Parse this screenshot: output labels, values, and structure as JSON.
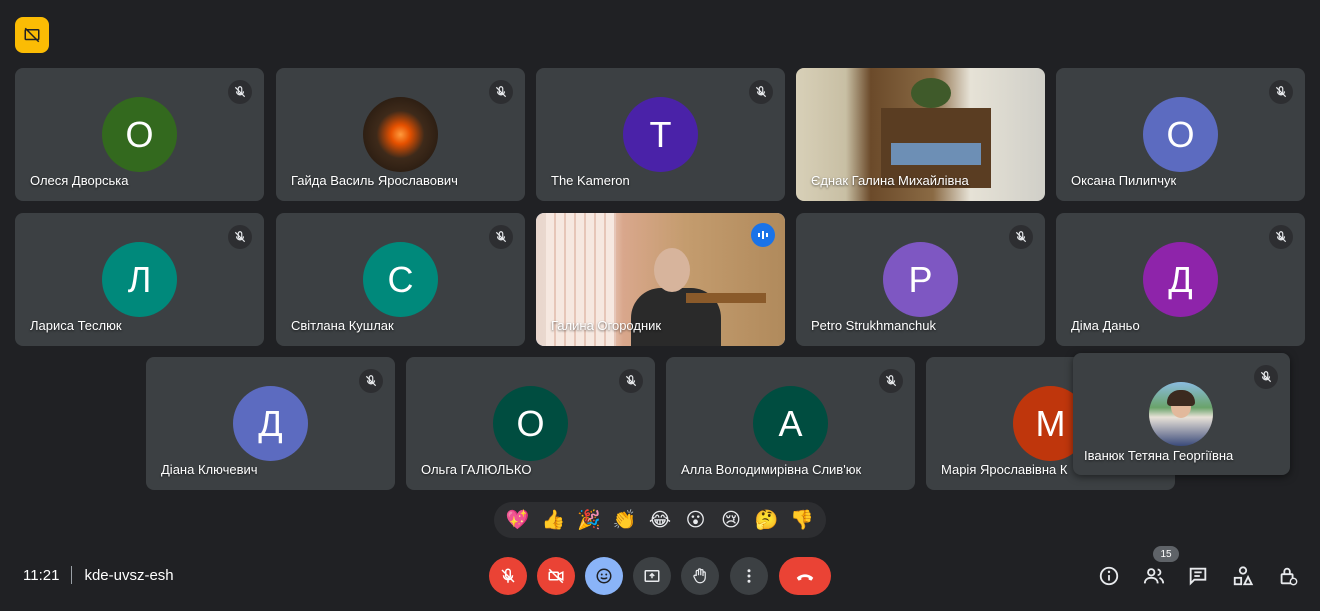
{
  "participants": [
    {
      "name": "Олеся Дворська",
      "initial": "О",
      "color": "#33691e"
    },
    {
      "name": "Гайда Василь Ярославович",
      "initial": "",
      "color": "#3e2a1a"
    },
    {
      "name": "The Kameron",
      "initial": "T",
      "color": "#4a22a8"
    },
    {
      "name": "Єднак Галина Михайлівна",
      "initial": "",
      "color": "#b9a98a"
    },
    {
      "name": "Оксана Пилипчук",
      "initial": "О",
      "color": "#5c6bc0"
    },
    {
      "name": "Лариса Теслюк",
      "initial": "Л",
      "color": "#00897b"
    },
    {
      "name": "Світлана Кушлак",
      "initial": "С",
      "color": "#00897b"
    },
    {
      "name": "Галина Огородник",
      "initial": "",
      "color": "#6d4c41"
    },
    {
      "name": "Petro Strukhmanchuk",
      "initial": "P",
      "color": "#7e57c2"
    },
    {
      "name": "Діма Даньо",
      "initial": "Д",
      "color": "#8e24aa"
    },
    {
      "name": "Діана Ключевич",
      "initial": "Д",
      "color": "#5c6bc0"
    },
    {
      "name": "Ольга ГАЛЮЛЬКО",
      "initial": "О",
      "color": "#004d40"
    },
    {
      "name": "Алла Володимирівна Слив'юк",
      "initial": "А",
      "color": "#004d40"
    },
    {
      "name": "Марія Ярославівна К",
      "initial": "М",
      "color": "#bf360c"
    }
  ],
  "floating": {
    "name": "Іванюк Тетяна Георгіївна"
  },
  "reactions": [
    "💖",
    "👍",
    "🎉",
    "👏",
    "😂",
    "😮",
    "😢",
    "🤔",
    "👎"
  ],
  "meeting": {
    "time": "11:21",
    "code": "kde-uvsz-esh"
  },
  "people_count": "15",
  "colors": {
    "background": "#202124",
    "tile": "#3c4043",
    "accent": "#8ab4f8",
    "danger": "#ea4335"
  }
}
